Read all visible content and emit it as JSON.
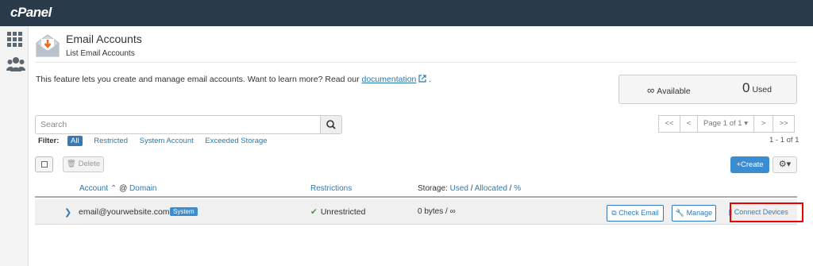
{
  "brand": {
    "logo_text": "cPanel"
  },
  "sidebar": {
    "items": [
      {
        "icon": "grid-icon"
      },
      {
        "icon": "users-icon"
      }
    ]
  },
  "header": {
    "title": "Email Accounts",
    "subtitle": "List Email Accounts"
  },
  "intro": {
    "text": "This feature lets you create and manage email accounts. Want to learn more? Read our ",
    "link": "documentation",
    "suffix": " ."
  },
  "stats": {
    "available_symbol": "∞",
    "available_label": "Available",
    "used_value": "0",
    "used_label": "Used"
  },
  "search": {
    "placeholder": "Search"
  },
  "filter": {
    "label": "Filter:",
    "options": [
      "All",
      "Restricted",
      "System Account",
      "Exceeded Storage"
    ],
    "active": "All"
  },
  "pagination": {
    "first": "<<",
    "prev": "<",
    "page_label": "Page 1 of 1",
    "next": ">",
    "last": ">>",
    "count": "1 - 1 of 1"
  },
  "toolbar": {
    "delete_label": "Delete",
    "create_label": "Create"
  },
  "table": {
    "headers": {
      "account": "Account",
      "at": "@",
      "domain": "Domain",
      "restrictions": "Restrictions",
      "storage_prefix": "Storage:",
      "storage_used": "Used",
      "storage_sep": "/",
      "storage_allocated": "Allocated",
      "storage_percent": "%"
    },
    "rows": [
      {
        "email": "email@yourwebsite.com",
        "badge": "System",
        "restrictions": "Unrestricted",
        "storage": "0 bytes / ∞",
        "actions": {
          "check_email": "Check Email",
          "manage": "Manage",
          "connect_devices": "Connect Devices"
        }
      }
    ]
  },
  "colors": {
    "topbar": "#293a4a",
    "accent": "#3a8dd1",
    "link": "#2a7ab0",
    "highlight": "#e00000"
  }
}
